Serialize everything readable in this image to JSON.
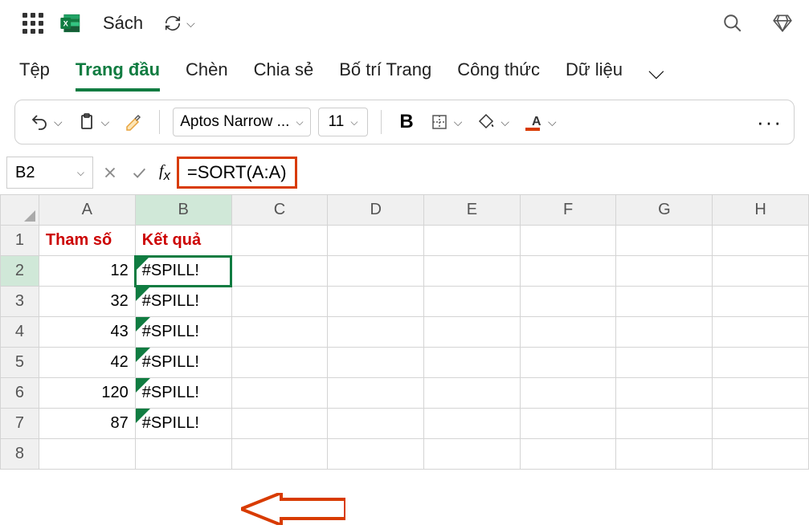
{
  "title": {
    "doc_name": "Sách"
  },
  "menu": {
    "items": [
      "Tệp",
      "Trang đầu",
      "Chèn",
      "Chia sẻ",
      "Bố trí Trang",
      "Công thức",
      "Dữ liệu"
    ],
    "active_index": 1
  },
  "toolbar": {
    "font": "Aptos Narrow ...",
    "size": "11"
  },
  "namebox": {
    "cell_ref": "B2"
  },
  "formula": {
    "value": "=SORT(A:A)"
  },
  "grid": {
    "columns": [
      "A",
      "B",
      "C",
      "D",
      "E",
      "F",
      "G",
      "H"
    ],
    "rows": [
      {
        "n": 1,
        "A": "Tham số",
        "B": "Kết quả",
        "header": true
      },
      {
        "n": 2,
        "A": "12",
        "B": "#SPILL!",
        "selected": true
      },
      {
        "n": 3,
        "A": "32",
        "B": "#SPILL!"
      },
      {
        "n": 4,
        "A": "43",
        "B": "#SPILL!"
      },
      {
        "n": 5,
        "A": "42",
        "B": "#SPILL!"
      },
      {
        "n": 6,
        "A": "120",
        "B": "#SPILL!"
      },
      {
        "n": 7,
        "A": "87",
        "B": "#SPILL!"
      },
      {
        "n": 8,
        "A": "",
        "B": ""
      }
    ]
  }
}
